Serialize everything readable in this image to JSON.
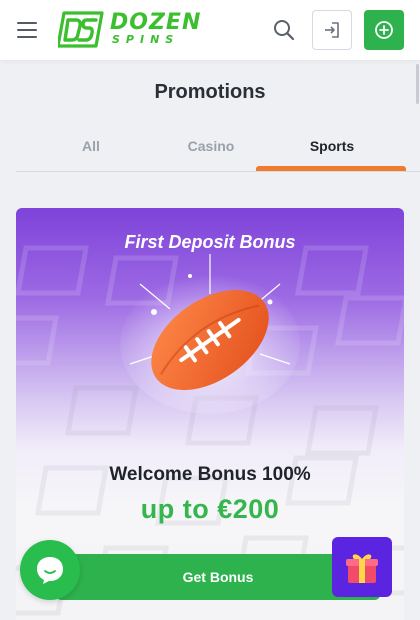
{
  "header": {
    "logo": {
      "word1": "DOZEN",
      "word2": "SPINS"
    },
    "icons": [
      "hamburger-menu-icon",
      "search-icon",
      "login-icon",
      "register-plus-icon"
    ]
  },
  "page": {
    "title": "Promotions"
  },
  "tabs": [
    {
      "label": "All",
      "active": false
    },
    {
      "label": "Casino",
      "active": false
    },
    {
      "label": "Sports",
      "active": true
    }
  ],
  "promo": {
    "title": "First Deposit Bonus",
    "welcome": "Welcome Bonus 100%",
    "amount": "up to €200",
    "button_label": "Get Bonus",
    "image": "american-football-icon"
  },
  "floating": {
    "chat_icon": "chat-icon",
    "gift_icon": "gift-icon"
  },
  "colors": {
    "brand_green": "#2eb24e",
    "accent_orange": "#f07b2c",
    "promo_purple": "#7e43d9",
    "gift_purple": "#5a24e0"
  }
}
